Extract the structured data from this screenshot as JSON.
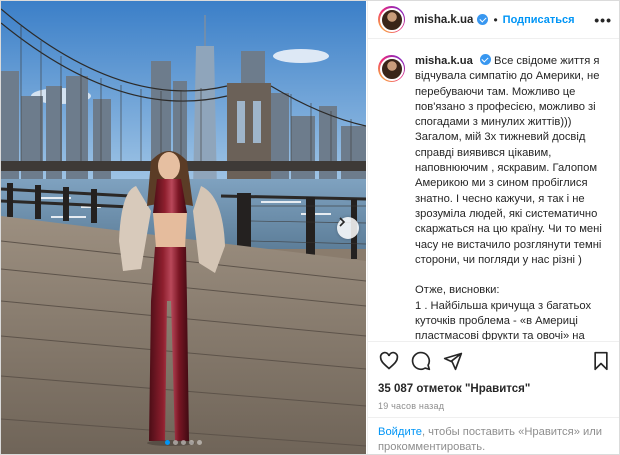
{
  "post": {
    "username": "misha.k.ua",
    "follow_label": "Подписаться",
    "separator": "•",
    "more_label": "•••",
    "caption": "Все свідоме життя я відчувала симпатію до Америки, не перебуваючи там. Можливо це пов'язано з професією, можливо зі спогадами з минулих життів))) Загалом, мій 3х тижневий досвід справді виявився цікавим, наповнюючим , яскравим. Галопом Америкою ми з сином пробіглися знатно. І чесно кажучи, я так і не зрозуміла людей, які систематично скаржаться на цю країну. Чи то мені часу не вистачило розглянути темні сторони, чи погляди у нас різні )\n\nОтже, висновки:\n1 . Найбільша кричуща з багатьох куточків проблема - «в Америці пластмасові фрукти та овочі» на моєму досвіді виявилася банальним стереотипом. Вірите, смачніше",
    "likes": "35 087 отметок \"Нравится\"",
    "time": "19 часов назад",
    "login_link_label": "Войдите",
    "login_prompt": ", чтобы поставить «Нравится» или прокомментировать."
  },
  "carousel": {
    "slides": 5,
    "active_slide": 1
  },
  "icons": [
    "heart-icon",
    "comment-icon",
    "share-icon",
    "bookmark-icon",
    "chevron-right-icon",
    "more-icon",
    "verified-icon"
  ],
  "colors": {
    "accent": "#0095f6",
    "verified": "#3897f0",
    "muted": "#8e8e8e",
    "text": "#262626"
  }
}
